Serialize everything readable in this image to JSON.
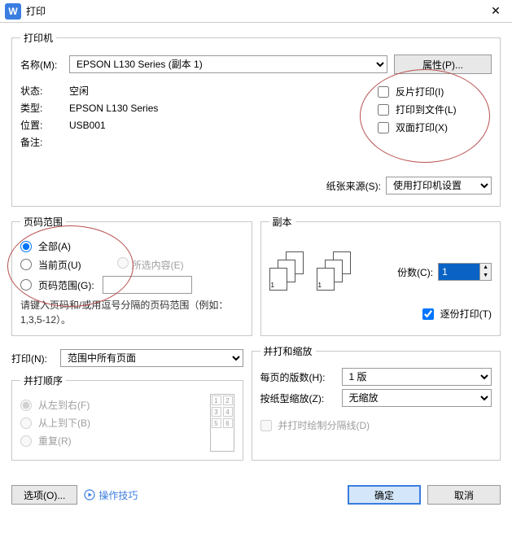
{
  "title": "打印",
  "app_icon": "W",
  "printer": {
    "legend": "打印机",
    "name_label": "名称(M):",
    "name_value": "EPSON L130 Series (副本 1)",
    "properties_btn": "属性(P)...",
    "status_label": "状态:",
    "status_value": "空闲",
    "type_label": "类型:",
    "type_value": "EPSON L130 Series",
    "location_label": "位置:",
    "location_value": "USB001",
    "notes_label": "备注:",
    "mirror_print": "反片打印(I)",
    "print_to_file": "打印到文件(L)",
    "duplex_print": "双面打印(X)",
    "paper_source_label": "纸张来源(S):",
    "paper_source_value": "使用打印机设置"
  },
  "range": {
    "legend": "页码范围",
    "all": "全部(A)",
    "current": "当前页(U)",
    "selection": "所选内容(E)",
    "pages": "页码范围(G):",
    "hint": "请键入页码和/或用逗号分隔的页码范围（例如：1,3,5-12）。"
  },
  "copies": {
    "legend": "副本",
    "count_label": "份数(C):",
    "count_value": "1",
    "collate": "逐份打印(T)"
  },
  "print_what": {
    "label": "打印(N):",
    "value": "范围中所有页面"
  },
  "merge_order": {
    "legend": "并打顺序",
    "ltr": "从左到右(F)",
    "ttb": "从上到下(B)",
    "repeat": "重复(R)"
  },
  "merge_scale": {
    "legend": "并打和缩放",
    "pages_per_sheet_label": "每页的版数(H):",
    "pages_per_sheet_value": "1 版",
    "scale_label": "按纸型缩放(Z):",
    "scale_value": "无缩放",
    "draw_lines": "并打时绘制分隔线(D)"
  },
  "footer": {
    "options": "选项(O)...",
    "tips": "操作技巧",
    "ok": "确定",
    "cancel": "取消"
  }
}
